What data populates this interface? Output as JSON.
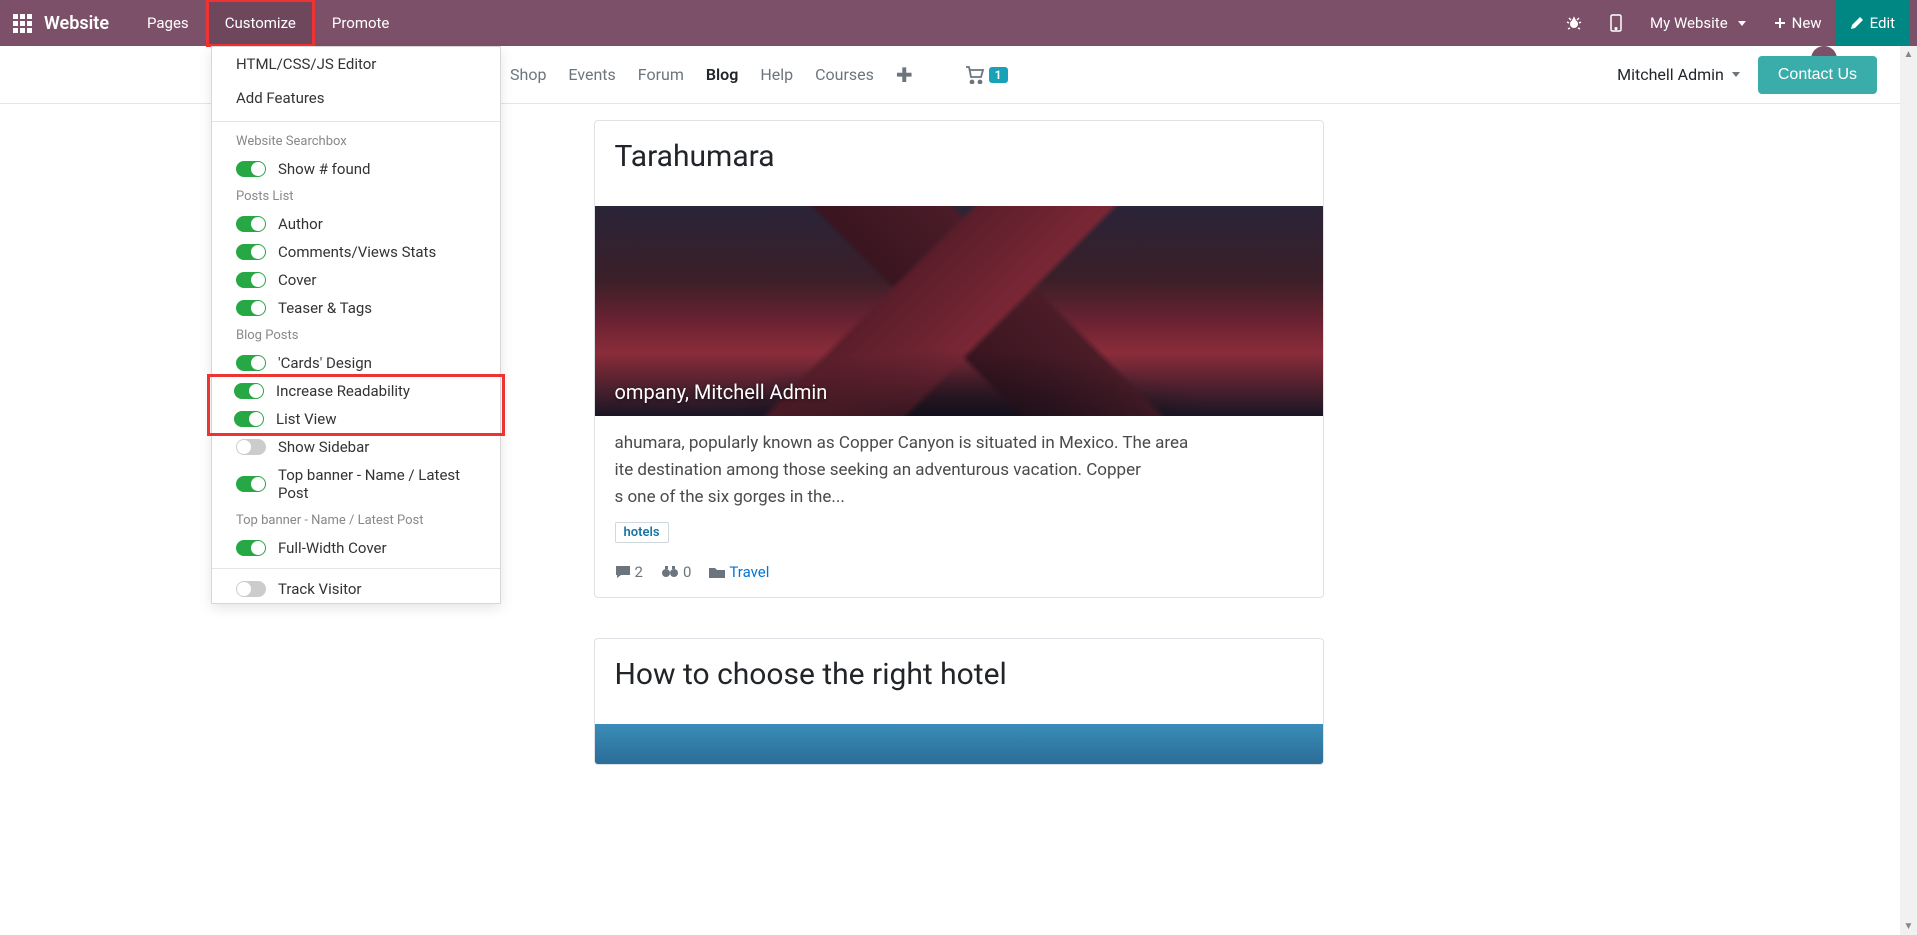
{
  "topbar": {
    "brand": "Website",
    "items": [
      "Pages",
      "Customize",
      "Promote"
    ],
    "website_dd": "My Website",
    "new_btn": "New",
    "edit_btn": "Edit"
  },
  "sitenav": {
    "items": [
      "Shop",
      "Events",
      "Forum",
      "Blog",
      "Help",
      "Courses"
    ],
    "active": "Blog",
    "cart_count": "1",
    "user": "Mitchell Admin",
    "contact": "Contact Us"
  },
  "dropdown": {
    "editor": "HTML/CSS/JS Editor",
    "addfeat": "Add Features",
    "g1_h": "Website Searchbox",
    "g1": [
      {
        "label": "Show # found",
        "on": true
      }
    ],
    "g2_h": "Posts List",
    "g2": [
      {
        "label": "Author",
        "on": true
      },
      {
        "label": "Comments/Views Stats",
        "on": true
      },
      {
        "label": "Cover",
        "on": true
      },
      {
        "label": "Teaser & Tags",
        "on": true
      }
    ],
    "g3_h": "Blog Posts",
    "g3": [
      {
        "label": "'Cards' Design",
        "on": true
      },
      {
        "label": "Increase Readability",
        "on": true
      },
      {
        "label": "List View",
        "on": true
      },
      {
        "label": "Show Sidebar",
        "on": false
      },
      {
        "label": "Top banner - Name / Latest Post",
        "on": true
      }
    ],
    "g4_h": "Top banner - Name / Latest Post",
    "g4": [
      {
        "label": "Full-Width Cover",
        "on": true
      }
    ],
    "g5": [
      {
        "label": "Track Visitor",
        "on": false
      }
    ]
  },
  "post1": {
    "title_visible": "Tarahumara",
    "author_line": "ompany, Mitchell Admin",
    "teaser_l1": "ahumara, popularly known as Copper Canyon is situated in Mexico. The area",
    "teaser_l2": "ite destination among those seeking an adventurous vacation. Copper",
    "teaser_l3": "s one of the six gorges in the...",
    "tag1": "hotels",
    "comments": "2",
    "views": "0",
    "category": "Travel"
  },
  "post2": {
    "title": "How to choose the right hotel"
  }
}
